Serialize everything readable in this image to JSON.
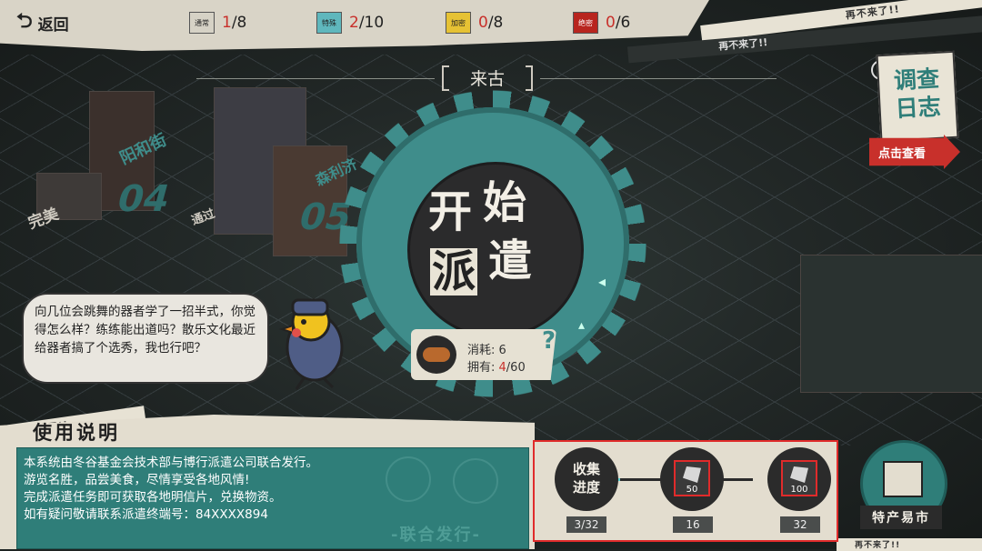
{
  "top_bar": {
    "back_label": "返回",
    "resources": [
      {
        "name": "通常",
        "color": "#d6d2c6",
        "current": "1",
        "total": "/8"
      },
      {
        "name": "特殊",
        "color": "#5fb7bd",
        "current": "2",
        "total": "/10"
      },
      {
        "name": "加密",
        "color": "#e6c234",
        "current": "0",
        "total": "/8"
      },
      {
        "name": "绝密",
        "color": "#b8251f",
        "current": "0",
        "total": "/6"
      }
    ]
  },
  "tape_text": "再不来了!!",
  "region_name": "来古",
  "map_labels": {
    "street1": "阳和街",
    "district1": "04",
    "street2": "森利济",
    "district2": "05",
    "done": "完美",
    "pass": "通过"
  },
  "start": {
    "c1": "开",
    "c2": "始",
    "c3": "派",
    "c4": "遣"
  },
  "cost": {
    "consume_label": "消耗: ",
    "consume_value": "6",
    "own_label": "拥有: ",
    "own_value": "4",
    "own_total": "/60",
    "help": "?"
  },
  "speech": "向几位会跳舞的器者学了一招半式，你觉得怎么样？练练能出道吗？散乐文化最近给器者搞了个选秀，我也行吧？",
  "manual": {
    "title": "使用说明",
    "lines": [
      "本系统由冬谷基金会技术部与博行派遣公司联合发行。",
      "游览名胜，品尝美食，尽情享受各地风情!",
      "完成派遣任务即可获取各地明信片，兑换物资。",
      "如有疑问敬请联系派遣终端号：84XXXX894"
    ],
    "joint": "-联合发行-"
  },
  "collection": {
    "label_l1": "收集",
    "label_l2": "进度",
    "progress": "3/32",
    "rewards": [
      {
        "amount": "50",
        "milestone": "16"
      },
      {
        "amount": "100",
        "milestone": "32"
      }
    ]
  },
  "market_label": "特产易市",
  "log": {
    "l1": "调查",
    "l2": "日志",
    "view": "点击查看"
  },
  "colors": {
    "teal": "#3f8d8b",
    "red": "#c8302b",
    "paper": "#e3ddcf"
  }
}
